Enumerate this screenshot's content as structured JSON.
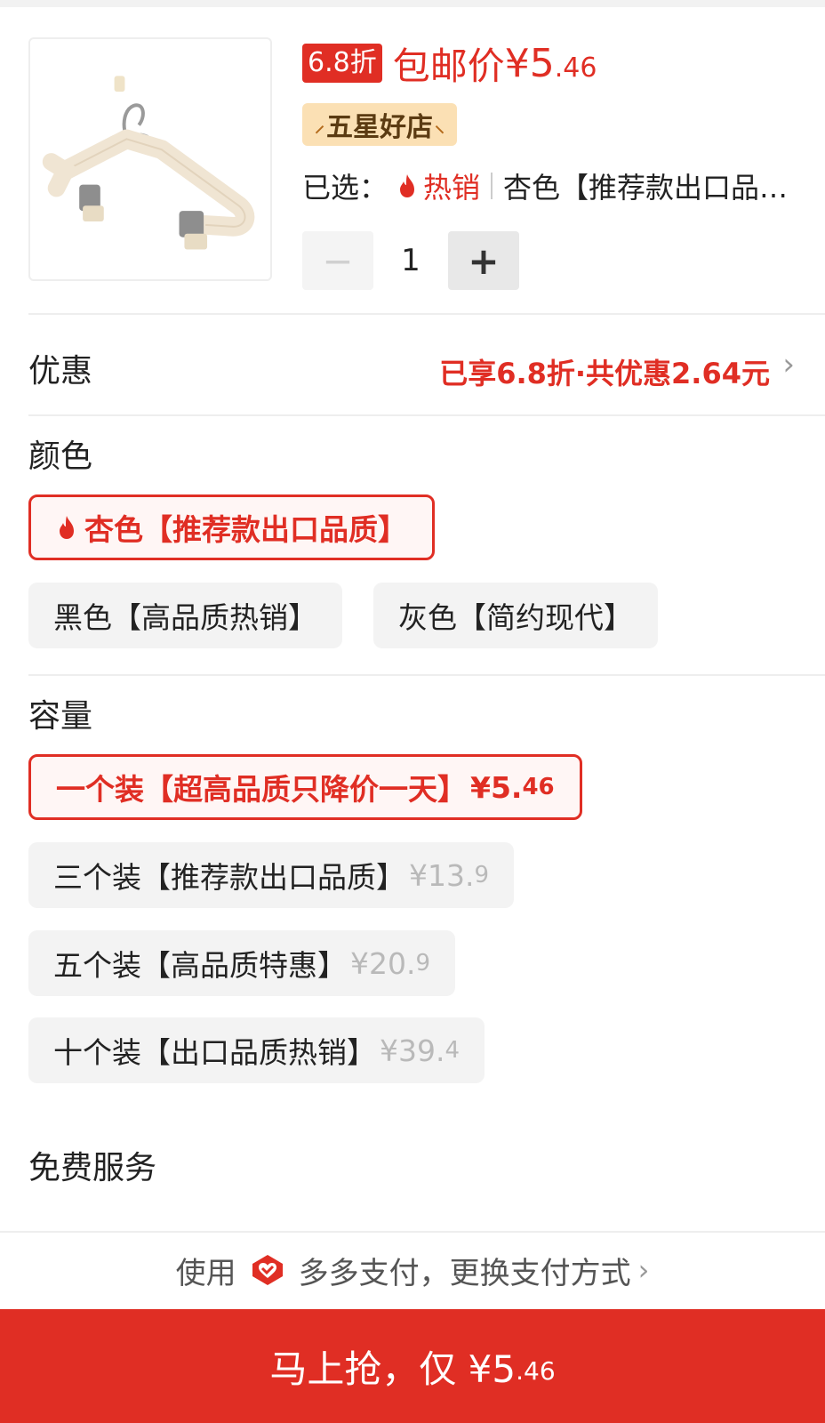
{
  "product": {
    "discount_tag": "6.8折",
    "price_label": "包邮价",
    "price_currency": "¥",
    "price_int": "5",
    "price_dec": ".46",
    "shop_badge": "五星好店",
    "selected_label": "已选：",
    "hot_label": "热销",
    "selected_value": "杏色【推荐款出口品…",
    "quantity": "1",
    "minus_glyph": "−",
    "plus_glyph": "+"
  },
  "discount": {
    "title": "优惠",
    "text": "已享6.8折·共优惠2.64元"
  },
  "color": {
    "title": "颜色",
    "options": [
      {
        "label": "杏色【推荐款出口品质】",
        "selected": true,
        "hot": true
      },
      {
        "label": "黑色【高品质热销】",
        "selected": false
      },
      {
        "label": "灰色【简约现代】",
        "selected": false
      }
    ]
  },
  "capacity": {
    "title": "容量",
    "options": [
      {
        "label": "一个装【超高品质只降价一天】",
        "price": "¥5.",
        "price_small": "46",
        "selected": true
      },
      {
        "label": "三个装【推荐款出口品质】",
        "price": "¥13.",
        "price_small": "9",
        "selected": false
      },
      {
        "label": "五个装【高品质特惠】",
        "price": "¥20.",
        "price_small": "9",
        "selected": false
      },
      {
        "label": "十个装【出口品质热销】",
        "price": "¥39.",
        "price_small": "4",
        "selected": false
      }
    ]
  },
  "services": {
    "title": "免费服务"
  },
  "payment": {
    "prefix": "使用",
    "text": "多多支付，更换支付方式",
    "icon": "heart-pay-icon"
  },
  "buy_button": {
    "label": "马上抢，仅 ¥5",
    "small": ".46"
  },
  "colors": {
    "accent": "#e02e24",
    "badge_bg": "#fbe0b4",
    "option_bg": "#f3f3f3"
  }
}
